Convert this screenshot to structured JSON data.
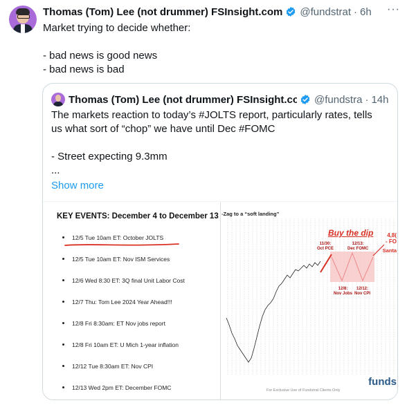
{
  "tweet": {
    "author_name": "Thomas (Tom) Lee (not drummer) FSInsight.com",
    "handle": "@fundstrat",
    "separator": "·",
    "time": "6h",
    "more_label": "···",
    "text_lines": [
      "Market trying to decide whether:",
      "",
      "- bad news is good news",
      "- bad news is bad"
    ]
  },
  "quote": {
    "author_name": "Thomas (Tom) Lee (not drummer) FSInsight.co",
    "handle": "@fundstra",
    "separator": "·",
    "time": "14h",
    "text_lines": [
      "The markets reaction to today’s #JOLTS report, particularly rates, tells",
      "us what sort of “chop” we have until Dec #FOMC",
      "",
      "- Street expecting 9.3mm",
      "..."
    ],
    "show_more": "Show more"
  },
  "media": {
    "events_title": "KEY EVENTS: December 4 to December 13",
    "events": [
      "12/5 Tue 10am ET: October JOLTS",
      "12/5 Tue 10am ET: Nov ISM Services",
      "12/6 Wed 8:30 ET: 3Q final Unit Labor Cost",
      "12/7 Thu: Tom Lee 2024 Year Ahead!!!",
      "12/8 Fri 8:30am: ET Nov jobs report",
      "12/8 Fri 10am ET: U Mich 1-year inflation",
      "12/12  Tue 8:30am ET: Nov CPI",
      "12/13 Wed 2pm ET: December FOMC"
    ],
    "chart_subtitle": "-Zag to a “soft landing”",
    "buy_the_dip": "Buy the dip",
    "right_cut_1": "4,8(",
    "right_cut_2": "- FO",
    "right_cut_3": "Santa",
    "label_oct_pce_date": "11/30:",
    "label_oct_pce": "Oct PCE",
    "label_dec_fomc_date": "12/13:",
    "label_dec_fomc": "Dec FOMC",
    "label_nov_jobs_date": "12/8:",
    "label_nov_jobs": "Nov Jobs",
    "label_nov_cpi_date": "12/12:",
    "label_nov_cpi": "Nov CPI",
    "footer_note": "For Exclusive Use of Fundstrat Clients Only",
    "logo_cut": "funds",
    "accent_red": "#d93025"
  }
}
